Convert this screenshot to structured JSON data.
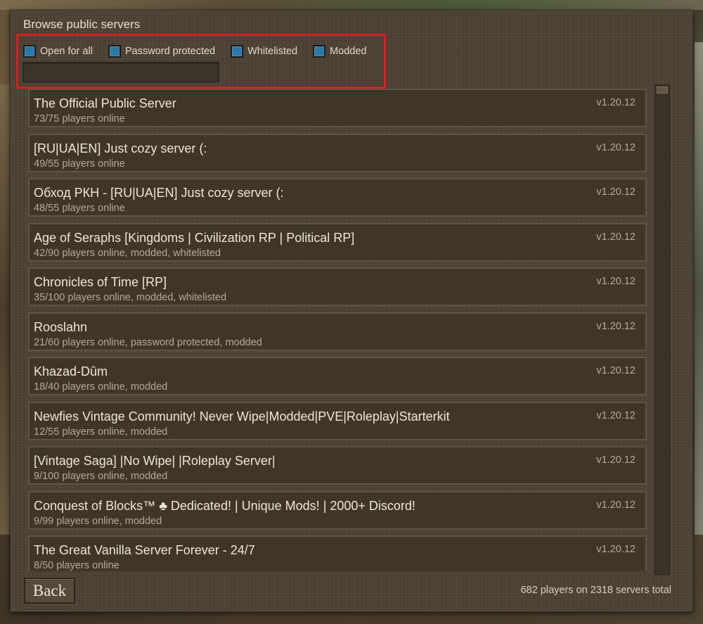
{
  "dialog": {
    "title": "Browse public servers"
  },
  "filters": [
    {
      "label": "Open for all",
      "checked": true
    },
    {
      "label": "Password protected",
      "checked": true
    },
    {
      "label": "Whitelisted",
      "checked": true
    },
    {
      "label": "Modded",
      "checked": true
    }
  ],
  "search": {
    "value": "",
    "placeholder": ""
  },
  "servers": [
    {
      "name": "The Official Public Server",
      "info": "73/75 players online",
      "version": "v1.20.12"
    },
    {
      "name": "[RU|UA|EN] Just cozy server (:",
      "info": "49/55 players online",
      "version": "v1.20.12"
    },
    {
      "name": "Обход РКН - [RU|UA|EN] Just cozy server (:",
      "info": "48/55 players online",
      "version": "v1.20.12"
    },
    {
      "name": "Age of Seraphs [Kingdoms | Civilization RP | Political RP]",
      "info": "42/90 players online, modded, whitelisted",
      "version": "v1.20.12"
    },
    {
      "name": "Chronicles of Time [RP]",
      "info": "35/100 players online, modded, whitelisted",
      "version": "v1.20.12"
    },
    {
      "name": "Rooslahn",
      "info": "21/60 players online, password protected, modded",
      "version": "v1.20.12"
    },
    {
      "name": "Khazad-Dûm",
      "info": "18/40 players online, modded",
      "version": "v1.20.12"
    },
    {
      "name": "Newfies Vintage Community! Never Wipe|Modded|PVE|Roleplay|Starterkit",
      "info": "12/55 players online, modded",
      "version": "v1.20.12"
    },
    {
      "name": "[Vintage Saga] |No Wipe| |Roleplay Server|",
      "info": "9/100 players online, modded",
      "version": "v1.20.12"
    },
    {
      "name": "Conquest of Blocks™ ♣ Dedicated! | Unique Mods! | 2000+ Discord!",
      "info": "9/99 players online, modded",
      "version": "v1.20.12"
    },
    {
      "name": "The Great Vanilla Server Forever - 24/7",
      "info": "8/50 players online",
      "version": "v1.20.12"
    }
  ],
  "footer": {
    "back_label": "Back",
    "totals": "682 players on 2318 servers total"
  },
  "colors": {
    "highlight": "#d42020",
    "checkbox": "#2b78a6",
    "panel": "#4c4235"
  }
}
